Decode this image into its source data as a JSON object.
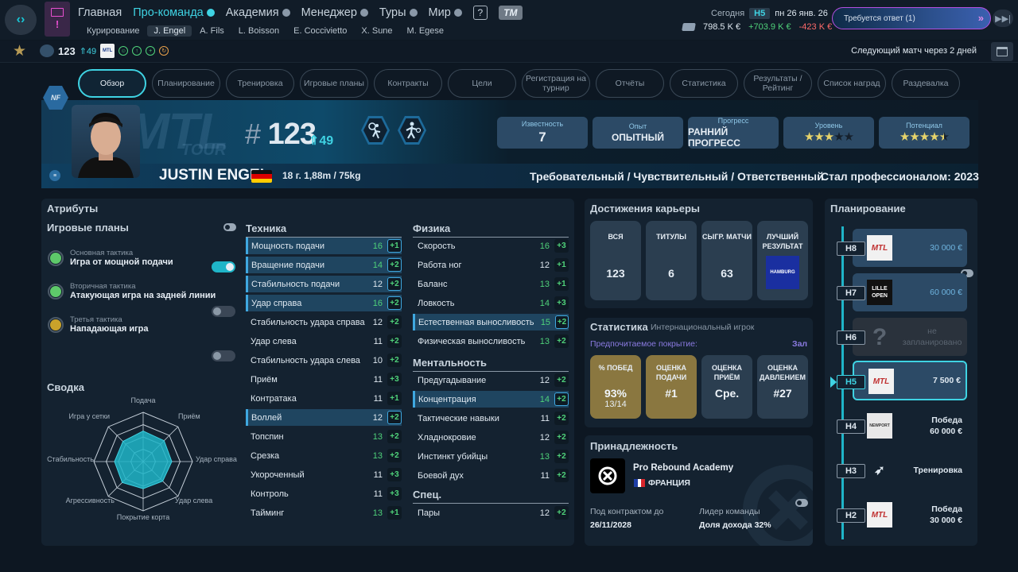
{
  "top": {
    "menu": [
      {
        "label": "Главная",
        "dot": false,
        "active": false
      },
      {
        "label": "Про-команда",
        "dot": true,
        "active": true
      },
      {
        "label": "Академия",
        "dot": true,
        "active": false
      },
      {
        "label": "Менеджер",
        "dot": true,
        "active": false
      },
      {
        "label": "Туры",
        "dot": true,
        "active": false
      },
      {
        "label": "Мир",
        "dot": true,
        "active": false
      }
    ],
    "help_label": "?",
    "tm_label": "TM",
    "submenu": [
      "Курирование",
      "J. Engel",
      "A. Fils",
      "L. Boisson",
      "E. Coccivietto",
      "X. Sune",
      "M. Egese"
    ],
    "today_label": "Сегодня",
    "week": "H5",
    "date": "пн 26 янв. 26",
    "balance": "798.5 K €",
    "income": "+703.9 K €",
    "expense": "-423 K €",
    "response_label": "Требуется ответ (1)",
    "skip_label": "▶▶|"
  },
  "row2": {
    "rank": "123",
    "rank_change": "49",
    "mtl_label": "MTL",
    "next_match": "Следующий матч через 2 дней"
  },
  "tabs": [
    {
      "label": "Обзор",
      "active": true
    },
    {
      "label": "Планирование",
      "active": false
    },
    {
      "label": "Тренировка",
      "active": false
    },
    {
      "label": "Игровые планы",
      "active": false
    },
    {
      "label": "Контракты",
      "active": false
    },
    {
      "label": "Цели",
      "active": false
    },
    {
      "label": "Регистрация на турнир",
      "active": false
    },
    {
      "label": "Отчёты",
      "active": false
    },
    {
      "label": "Статистика",
      "active": false
    },
    {
      "label": "Результаты / Рейтинг",
      "active": false
    },
    {
      "label": "Список наград",
      "active": false
    },
    {
      "label": "Раздевалка",
      "active": false
    }
  ],
  "player": {
    "logo_text": "NF",
    "bg_mtl": "MTL",
    "bg_tour": "TOUR",
    "hash": "#",
    "rank": "123",
    "rank_change": "49",
    "name": "JUSTIN ENGEL",
    "info": "18 г.  1,88m / 75kg",
    "traits": "Требовательный / Чувствительный / Ответственный",
    "pro_since": "Стал профессионалом: 2023",
    "cards": [
      {
        "label": "Известность",
        "value": "7",
        "stars": null
      },
      {
        "label": "Опыт",
        "value": "ОПЫТНЫЙ",
        "stars": null
      },
      {
        "label": "Прогресс",
        "value": "РАННИЙ ПРОГРЕСС",
        "stars": null
      },
      {
        "label": "Уровень",
        "value": "",
        "stars": 3
      },
      {
        "label": "Потенциал",
        "value": "",
        "stars": 4.5
      }
    ],
    "colors": {
      "accent": "#3fd3e3",
      "star": "#e6d36b"
    }
  },
  "attributes": {
    "title": "Атрибуты",
    "plans_title": "Игровые планы",
    "tactics": [
      {
        "sub": "Основная тактика",
        "name": "Игра от мощной подачи",
        "color": "#5ec96a",
        "on": true
      },
      {
        "sub": "Вторичная тактика",
        "name": "Атакующая игра на задней линии",
        "color": "#5ec96a",
        "on": false
      },
      {
        "sub": "Третья тактика",
        "name": "Нападающая игра",
        "color": "#c9a22a",
        "on": false
      }
    ],
    "summary_title": "Сводка",
    "radar": {
      "labels": [
        "Подача",
        "Приём",
        "Удар справа",
        "Удар слева",
        "Покрытие корта",
        "Агрессивность",
        "Стабильность",
        "Игра у сетки"
      ],
      "values": [
        0.62,
        0.6,
        0.58,
        0.56,
        0.55,
        0.6,
        0.58,
        0.58
      ]
    },
    "technique_title": "Техника",
    "technique": [
      {
        "name": "Мощность подачи",
        "value": "16",
        "bonus": "+1",
        "hl": true,
        "green": true
      },
      {
        "name": "Вращение подачи",
        "value": "14",
        "bonus": "+2",
        "hl": true,
        "green": true
      },
      {
        "name": "Стабильность подачи",
        "value": "12",
        "bonus": "+2",
        "hl": true,
        "green": false
      },
      {
        "name": "Удар справа",
        "value": "16",
        "bonus": "+2",
        "hl": true,
        "green": true
      },
      {
        "name": "Стабильность удара справа",
        "value": "12",
        "bonus": "+2",
        "hl": false,
        "green": false
      },
      {
        "name": "Удар слева",
        "value": "11",
        "bonus": "+2",
        "hl": false,
        "green": false
      },
      {
        "name": "Стабильность удара слева",
        "value": "10",
        "bonus": "+2",
        "hl": false,
        "green": false
      },
      {
        "name": "Приём",
        "value": "11",
        "bonus": "+3",
        "hl": false,
        "green": false
      },
      {
        "name": "Контратака",
        "value": "11",
        "bonus": "+1",
        "hl": false,
        "green": false
      },
      {
        "name": "Воллей",
        "value": "12",
        "bonus": "+2",
        "hl": true,
        "green": false
      },
      {
        "name": "Топспин",
        "value": "13",
        "bonus": "+2",
        "hl": false,
        "green": true
      },
      {
        "name": "Срезка",
        "value": "13",
        "bonus": "+2",
        "hl": false,
        "green": true
      },
      {
        "name": "Укороченный",
        "value": "11",
        "bonus": "+3",
        "hl": false,
        "green": false
      },
      {
        "name": "Контроль",
        "value": "11",
        "bonus": "+3",
        "hl": false,
        "green": false
      },
      {
        "name": "Тайминг",
        "value": "13",
        "bonus": "+1",
        "hl": false,
        "green": true
      }
    ],
    "physics_title": "Физика",
    "physics": [
      {
        "name": "Скорость",
        "value": "16",
        "bonus": "+3",
        "hl": false,
        "green": true
      },
      {
        "name": "Работа ног",
        "value": "12",
        "bonus": "+1",
        "hl": false,
        "green": false
      },
      {
        "name": "Баланс",
        "value": "13",
        "bonus": "+1",
        "hl": false,
        "green": true
      },
      {
        "name": "Ловкость",
        "value": "14",
        "bonus": "+3",
        "hl": false,
        "green": true
      },
      {
        "name": "Естественная выносливость",
        "value": "15",
        "bonus": "+2",
        "hl": true,
        "green": true
      },
      {
        "name": "Физическая выносливость",
        "value": "13",
        "bonus": "+2",
        "hl": false,
        "green": true
      }
    ],
    "mental_title": "Ментальность",
    "mental": [
      {
        "name": "Предугадывание",
        "value": "12",
        "bonus": "+2",
        "hl": false,
        "green": false
      },
      {
        "name": "Концентрация",
        "value": "14",
        "bonus": "+2",
        "hl": true,
        "green": true
      },
      {
        "name": "Тактические навыки",
        "value": "11",
        "bonus": "+2",
        "hl": false,
        "green": false
      },
      {
        "name": "Хладнокровие",
        "value": "12",
        "bonus": "+2",
        "hl": false,
        "green": false
      },
      {
        "name": "Инстинкт убийцы",
        "value": "13",
        "bonus": "+2",
        "hl": false,
        "green": true
      },
      {
        "name": "Боевой дух",
        "value": "11",
        "bonus": "+2",
        "hl": false,
        "green": false
      }
    ],
    "special_title": "Спец.",
    "special": [
      {
        "name": "Пары",
        "value": "12",
        "bonus": "+2",
        "hl": false,
        "green": false
      }
    ]
  },
  "career": {
    "title": "Достижения карьеры",
    "cards": [
      {
        "label": "ВСЯ",
        "value": "123"
      },
      {
        "label": "ТИТУЛЫ",
        "value": "6"
      },
      {
        "label": "СЫГР. МАТЧИ",
        "value": "63"
      },
      {
        "label": "ЛУЧШИЙ РЕЗУЛЬТАТ",
        "value": ""
      }
    ],
    "best_logo": "HAMBURG"
  },
  "stats": {
    "title": "Статистика",
    "subtitle": "Интернациональный игрок",
    "surface_label": "Предпочитаемое покрытие:",
    "surface_value": "Зал",
    "cards": [
      {
        "label": "% ПОБЕД",
        "value": "93%",
        "sub": "13/14",
        "gold": true
      },
      {
        "label": "ОЦЕНКА ПОДАЧИ",
        "value": "#1",
        "sub": "",
        "gold": true
      },
      {
        "label": "ОЦЕНКА ПРИЁМ",
        "value": "Сре.",
        "sub": "",
        "gold": false
      },
      {
        "label": "ОЦЕНКА ДАВЛЕНИЕМ",
        "value": "#27",
        "sub": "",
        "gold": false
      }
    ]
  },
  "affiliation": {
    "title": "Принадлежность",
    "academy": "Pro Rebound Academy",
    "country": "ФРАНЦИЯ",
    "contract_label": "Под контрактом до",
    "contract_value": "26/11/2028",
    "leader_label": "Лидер команды",
    "leader_value": "Доля дохода 32%"
  },
  "planning": {
    "title": "Планирование",
    "items": [
      {
        "week": "H8",
        "logo": "MTL",
        "text": "30 000 €",
        "type": "future"
      },
      {
        "week": "H7",
        "logo": "LILLE OPEN",
        "text": "60 000 €",
        "type": "future"
      },
      {
        "week": "H6",
        "logo": "?",
        "text": "не запланировано",
        "type": "empty"
      },
      {
        "week": "H5",
        "logo": "MTL",
        "text": "7 500 €",
        "type": "current"
      },
      {
        "week": "H4",
        "logo": "NEWPORT",
        "text": "Победа\n60 000 €",
        "type": "past"
      },
      {
        "week": "H3",
        "logo": "",
        "text": "Тренировка",
        "type": "past"
      },
      {
        "week": "H2",
        "logo": "MTL",
        "text": "Победа\n30 000 €",
        "type": "past"
      }
    ]
  }
}
